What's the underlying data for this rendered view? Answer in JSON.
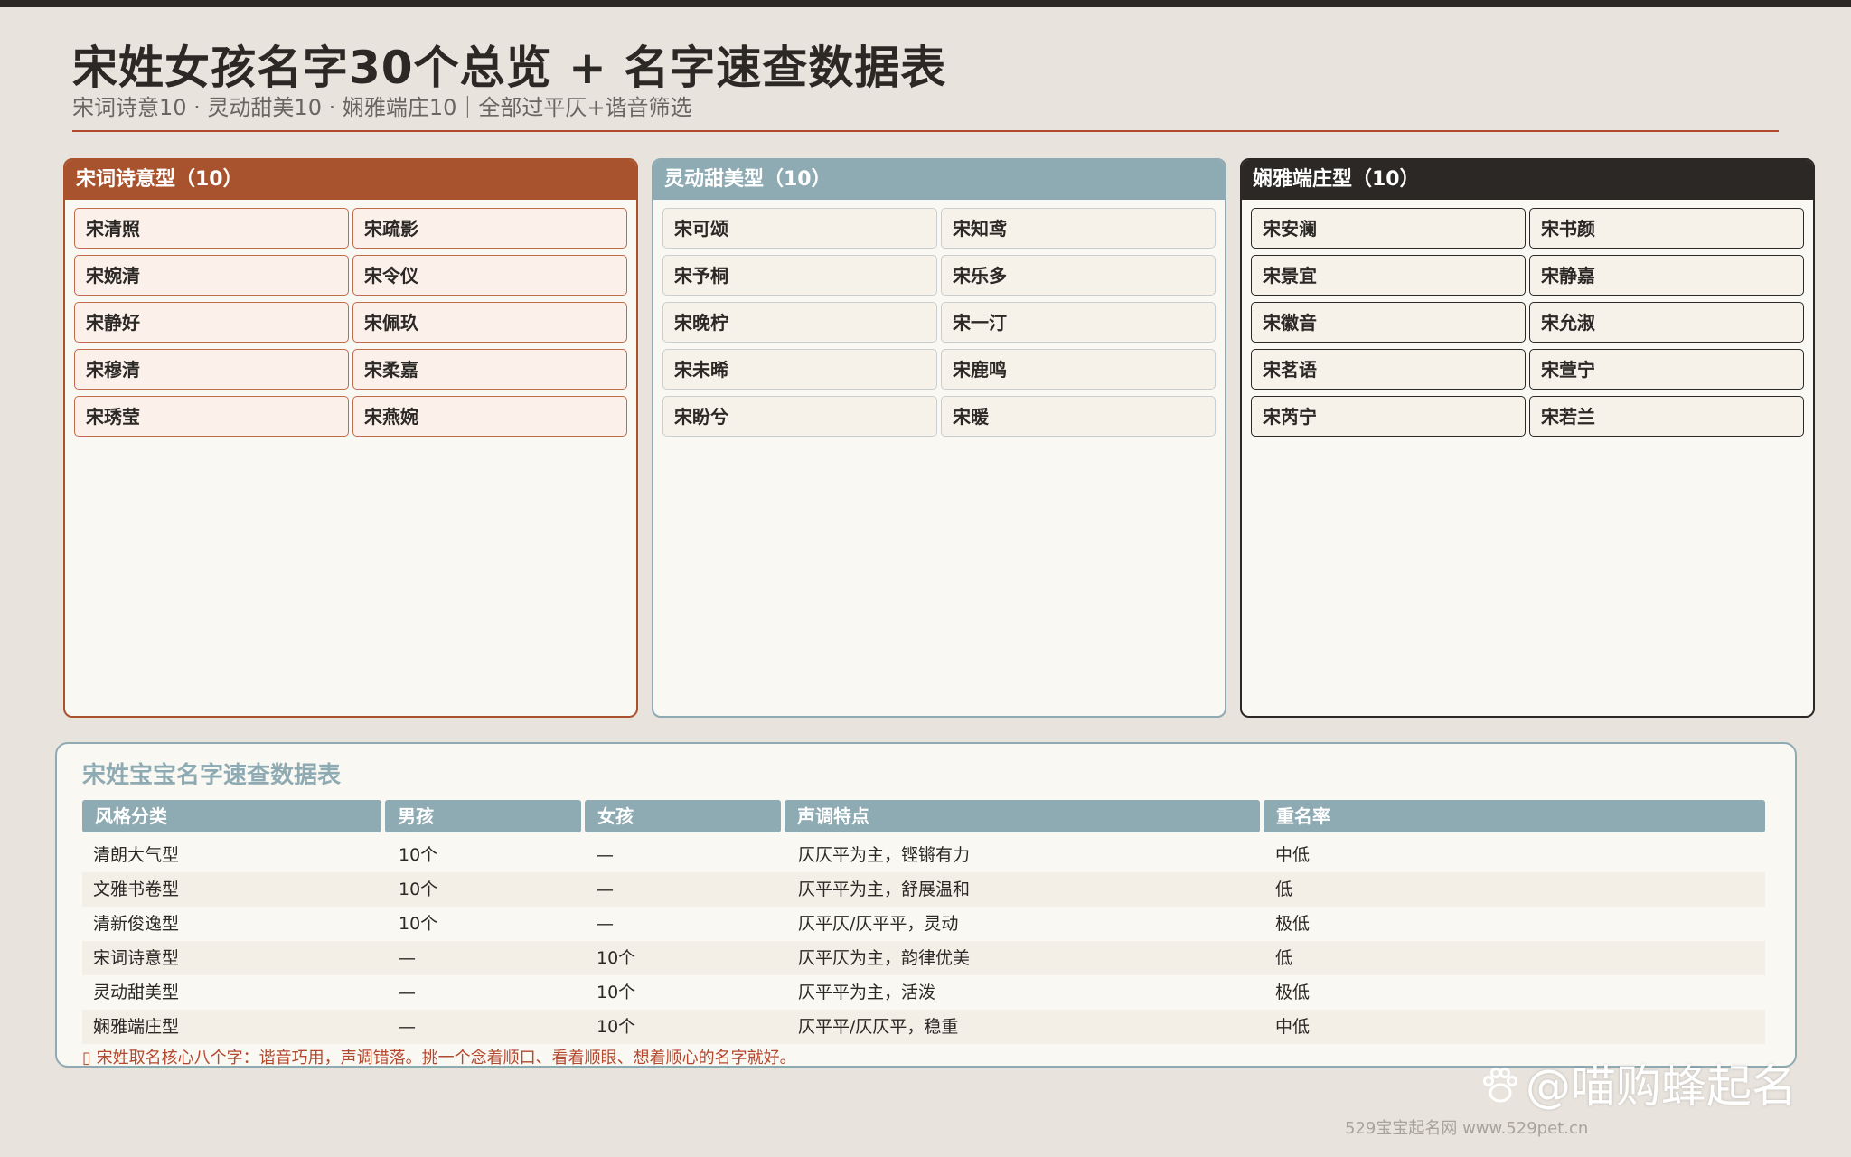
{
  "header": {
    "title": "宋姓女孩名字30个总览 + 名字速查数据表",
    "subtitle": "宋词诗意10 · 灵动甜美10 · 娴雅端庄10｜全部过平仄+谐音筛选"
  },
  "panels": {
    "poetic": {
      "title": "宋词诗意型（10）",
      "names": [
        "宋清照",
        "宋疏影",
        "宋婉清",
        "宋令仪",
        "宋静好",
        "宋佩玖",
        "宋穆清",
        "宋柔嘉",
        "宋琇莹",
        "宋燕婉"
      ]
    },
    "lively": {
      "title": "灵动甜美型（10）",
      "names": [
        "宋可颂",
        "宋知鸢",
        "宋予桐",
        "宋乐多",
        "宋晚柠",
        "宋一汀",
        "宋未晞",
        "宋鹿鸣",
        "宋盼兮",
        "宋暖"
      ]
    },
    "elegant": {
      "title": "娴雅端庄型（10）",
      "names": [
        "宋安澜",
        "宋书颜",
        "宋景宜",
        "宋静嘉",
        "宋徽音",
        "宋允淑",
        "宋茗语",
        "宋萱宁",
        "宋芮宁",
        "宋若兰"
      ]
    }
  },
  "table": {
    "title": "宋姓宝宝名字速查数据表",
    "columns": [
      "风格分类",
      "男孩",
      "女孩",
      "声调特点",
      "重名率"
    ],
    "rows": [
      [
        "清朗大气型",
        "10个",
        "—",
        "仄仄平为主，铿锵有力",
        "中低"
      ],
      [
        "文雅书卷型",
        "10个",
        "—",
        "仄平平为主，舒展温和",
        "低"
      ],
      [
        "清新俊逸型",
        "10个",
        "—",
        "仄平仄/仄平平，灵动",
        "极低"
      ],
      [
        "宋词诗意型",
        "—",
        "10个",
        "仄平仄为主，韵律优美",
        "低"
      ],
      [
        "灵动甜美型",
        "—",
        "10个",
        "仄平平为主，活泼",
        "极低"
      ],
      [
        "娴雅端庄型",
        "—",
        "10个",
        "仄平平/仄仄平，稳重",
        "中低"
      ]
    ],
    "note": "▯ 宋姓取名核心八个字：谐音巧用，声调错落。挑一个念着顺口、看着顺眼、想着顺心的名字就好。"
  },
  "watermark": {
    "text": "@喵购蜂起名",
    "icon": "paw-icon"
  },
  "footer": {
    "site": "529宝宝起名网  www.529pet.cn"
  },
  "colors": {
    "background": "#e8e3dc",
    "accent_rust": "#a9532e",
    "accent_blue": "#8eaab3",
    "dark": "#2b2826",
    "note_red": "#b2482e"
  }
}
